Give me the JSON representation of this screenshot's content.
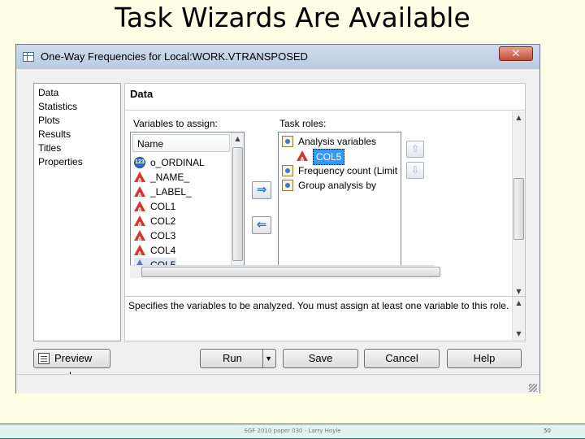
{
  "slide": {
    "title": "Task Wizards Are Available",
    "footer": "SGF 2010 paper 030 - Larry Hoyle",
    "page_number": "50"
  },
  "window": {
    "title": "One-Way Frequencies for Local:WORK.VTRANSPOSED",
    "close_glyph": "✕"
  },
  "nav": {
    "items": [
      "Data",
      "Statistics",
      "Plots",
      "Results",
      "Titles",
      "Properties"
    ],
    "selected": "Data"
  },
  "data_page": {
    "title": "Data",
    "variables_label": "Variables to assign:",
    "roles_label": "Task roles:",
    "list_header": "Name",
    "variables": [
      {
        "name": "o_ORDINAL",
        "type": "numeric"
      },
      {
        "name": "_NAME_",
        "type": "character"
      },
      {
        "name": "_LABEL_",
        "type": "character"
      },
      {
        "name": "COL1",
        "type": "character"
      },
      {
        "name": "COL2",
        "type": "character"
      },
      {
        "name": "COL3",
        "type": "character"
      },
      {
        "name": "COL4",
        "type": "character"
      },
      {
        "name": "COL5",
        "type": "character-selected"
      }
    ],
    "roles": [
      {
        "name": "Analysis variables"
      },
      {
        "name": "COL5",
        "assigned": true
      },
      {
        "name": "Frequency count  (Limit"
      },
      {
        "name": "Group analysis by"
      }
    ],
    "assign_arrow": "⇒",
    "remove_arrow": "⇐",
    "up_arrow": "⇧",
    "down_arrow": "⇩",
    "description": "Specifies the variables to be analyzed. You must assign at least one variable to this role."
  },
  "buttons": {
    "preview": "Preview code",
    "run": "Run",
    "save": "Save",
    "cancel": "Cancel",
    "help": "Help"
  },
  "icon_names": [
    "window-icon",
    "close-icon",
    "numeric-var-icon",
    "character-var-icon",
    "role-icon",
    "preview-icon",
    "dropdown-icon",
    "size-grip-icon"
  ],
  "colors": {
    "slide_background": "#ffffe6",
    "title_bar": "#c4d5ea",
    "close_button": "#c24c36",
    "selection": "#3399ff",
    "footer_rule": "#0b78b5"
  }
}
